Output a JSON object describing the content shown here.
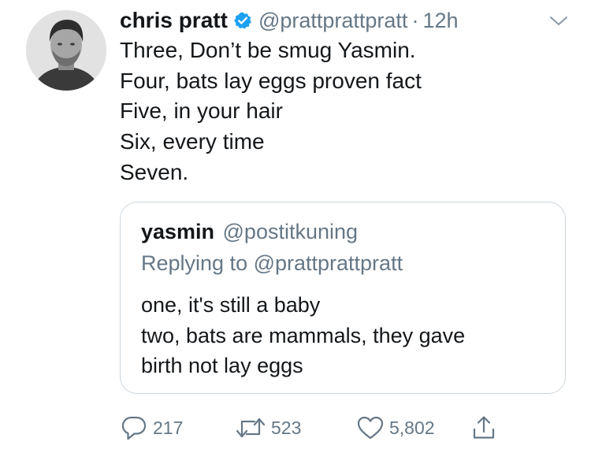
{
  "tweet": {
    "author_name": "chris pratt",
    "author_handle": "@prattprattpratt",
    "separator": "·",
    "time": "12h",
    "lines": [
      "Three, Don’t be smug Yasmin.",
      "Four, bats lay eggs proven fact",
      "Five, in your hair",
      "Six, every time",
      "Seven."
    ]
  },
  "quote": {
    "author_name": "yasmin",
    "author_handle": "@postitkuning",
    "replying_to": "Replying to @prattprattpratt",
    "lines": [
      "one, it's still a baby",
      "two, bats are mammals, they gave",
      "birth not lay eggs"
    ]
  },
  "actions": {
    "replies": "217",
    "retweets": "523",
    "likes": "5,802"
  },
  "icons": {
    "verified": "verified-badge-icon",
    "chevron": "chevron-down-icon",
    "reply": "reply-icon",
    "retweet": "retweet-icon",
    "like": "heart-icon",
    "share": "share-icon"
  },
  "colors": {
    "text": "#14171a",
    "secondary": "#657786",
    "border": "#ccd6dd",
    "verified": "#1da1f2"
  }
}
